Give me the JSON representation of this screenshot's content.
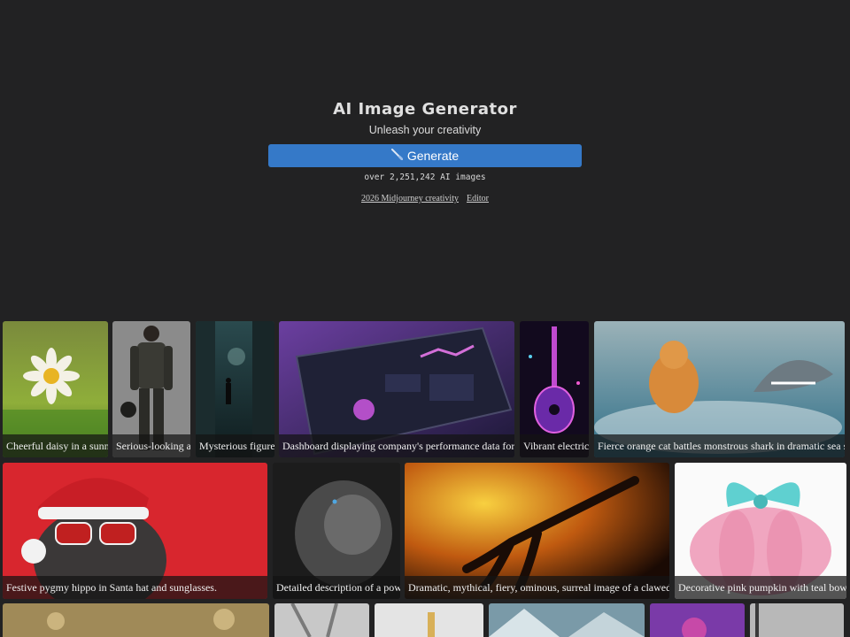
{
  "hero": {
    "title": "AI Image Generator",
    "subtitle": "Unleash your creativity",
    "generate_label": "Generate",
    "generate_icon": "brush-icon",
    "count_text": "over 2,251,242 AI images",
    "links": [
      "2026 Midjourney creativity",
      "Editor"
    ]
  },
  "gallery": {
    "row1": [
      "Cheerful daisy in a sunny meadow",
      "Serious-looking a",
      "Mysterious figure",
      "Dashboard displaying company's performance data for",
      "Vibrant electric",
      "Fierce orange cat battles monstrous shark in dramatic sea s"
    ],
    "row2": [
      "Festive pygmy hippo in Santa hat and sunglasses.",
      "Detailed description of a pow",
      "Dramatic, mythical, fiery, ominous, surreal image of a clawed",
      "Decorative pink pumpkin with teal bow"
    ]
  },
  "colors": {
    "background": "#222223",
    "accent": "#3579c8"
  }
}
